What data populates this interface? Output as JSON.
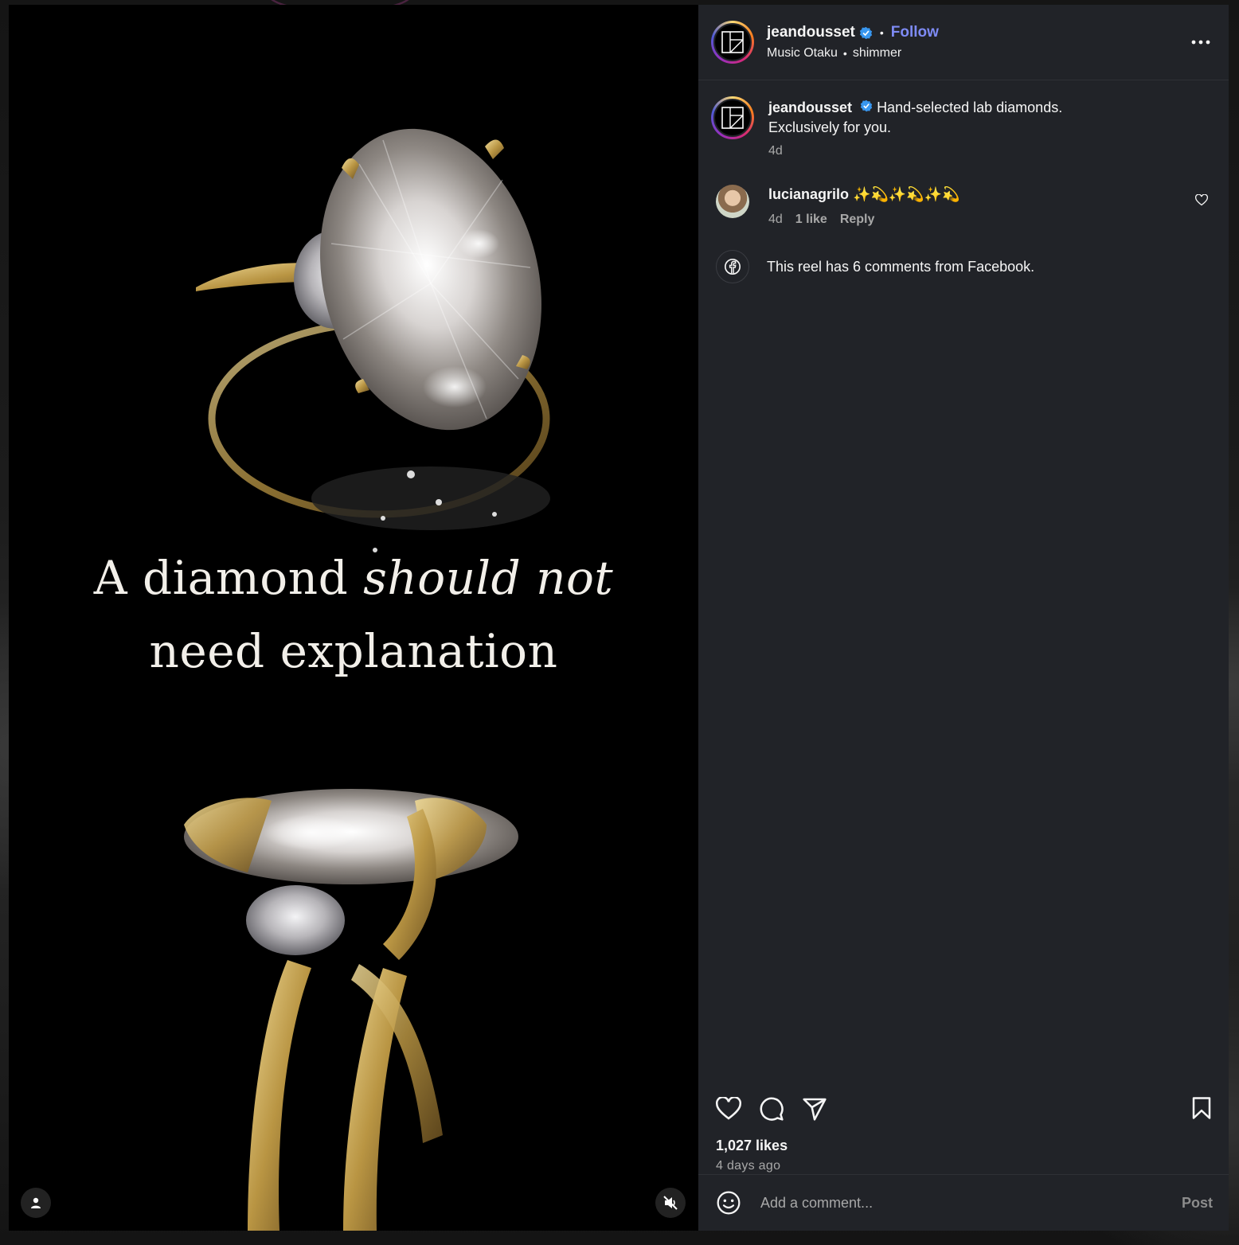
{
  "post": {
    "author": "jeandousset",
    "follow_label": "Follow",
    "audio_artist": "Music Otaku",
    "audio_track": "shimmer",
    "more_label": "..."
  },
  "media": {
    "overlay_line1_a": "A diamond",
    "overlay_line1_b": "should not",
    "overlay_line2": "need explanation"
  },
  "caption": {
    "author": "jeandousset",
    "text_line1": "Hand-selected lab diamonds.",
    "text_line2": "Exclusively for you.",
    "time": "4d"
  },
  "comments": [
    {
      "author": "lucianagrilo",
      "text": "✨💫✨💫✨💫",
      "time": "4d",
      "likes": "1 like",
      "reply_label": "Reply"
    }
  ],
  "facebook_note": "This reel has 6 comments from Facebook.",
  "stats": {
    "likes": "1,027 likes",
    "posted": "4 days ago"
  },
  "composer": {
    "placeholder": "Add a comment...",
    "post_label": "Post"
  },
  "colors": {
    "panel_bg": "#212328",
    "follow": "#7e8bf5",
    "verified": "#3897f0"
  },
  "icons": {
    "header_more": "more-icon",
    "verified": "verified-badge-icon",
    "like": "heart-icon",
    "comment": "comment-icon",
    "share": "share-icon",
    "save": "bookmark-icon",
    "emoji": "emoji-icon",
    "facebook": "facebook-icon",
    "mute": "speaker-muted-icon",
    "tagged": "person-icon"
  }
}
